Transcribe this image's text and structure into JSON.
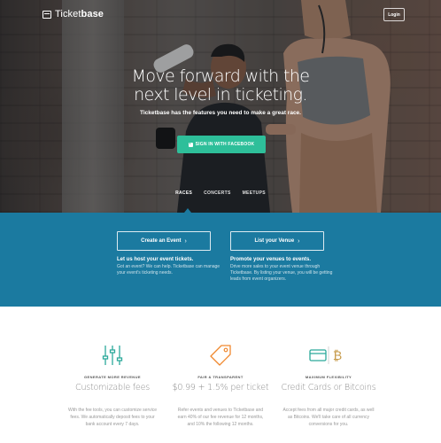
{
  "header": {
    "logo_prefix": "Ticket",
    "logo_bold": "base",
    "login_label": "Login"
  },
  "hero": {
    "title_line1": "Move forward with the",
    "title_line2": "next level in ticketing.",
    "subtitle": "Ticketbase has the features you need to make a great race.",
    "facebook_button": "SIGN IN WITH FACEBOOK",
    "tabs": [
      {
        "label": "RACES",
        "active": true
      },
      {
        "label": "CONCERTS",
        "active": false
      },
      {
        "label": "MEETUPS",
        "active": false
      }
    ]
  },
  "band": {
    "color": "#1b7aa0",
    "create_event_button": "Create an Event",
    "list_venue_button": "List your Venue",
    "left_heading": "Let us host your event tickets.",
    "left_text": "Got an event? We can help. Ticketbase can manage your event's ticketing needs.",
    "right_heading": "Promote your venues to events.",
    "right_text": "Drive more sales to your event venue through Ticketbase. By listing your venue, you will be getting leads from event organizers."
  },
  "features": [
    {
      "icon": "sliders-icon",
      "kicker": "GENERATE MORE REVENUE",
      "title": "Customizable fees",
      "text": "With the fee tools, you can customize service fees. We automatically deposit fees to your bank account every 7 days."
    },
    {
      "icon": "price-tag-icon",
      "kicker": "FAIR & TRANSPARENT",
      "title": "$0.99 + 1.5% per ticket",
      "text": "Refer events and venues to Ticketbase and earn 40% of our fee revenue for 12 months, and 10% the following 12 months."
    },
    {
      "icon": "credit-card-bitcoin-icon",
      "kicker": "MAXIMUM FLEXIBILITY",
      "title": "Credit Cards or Bitcoins",
      "text": "Accept fees from all major credit cards, as well as Bitcoins. We'll take care of all currency conversions for you."
    }
  ],
  "colors": {
    "accent_green": "#2ebf9a",
    "icon_teal": "#2ba99a",
    "icon_orange": "#f0892f"
  }
}
